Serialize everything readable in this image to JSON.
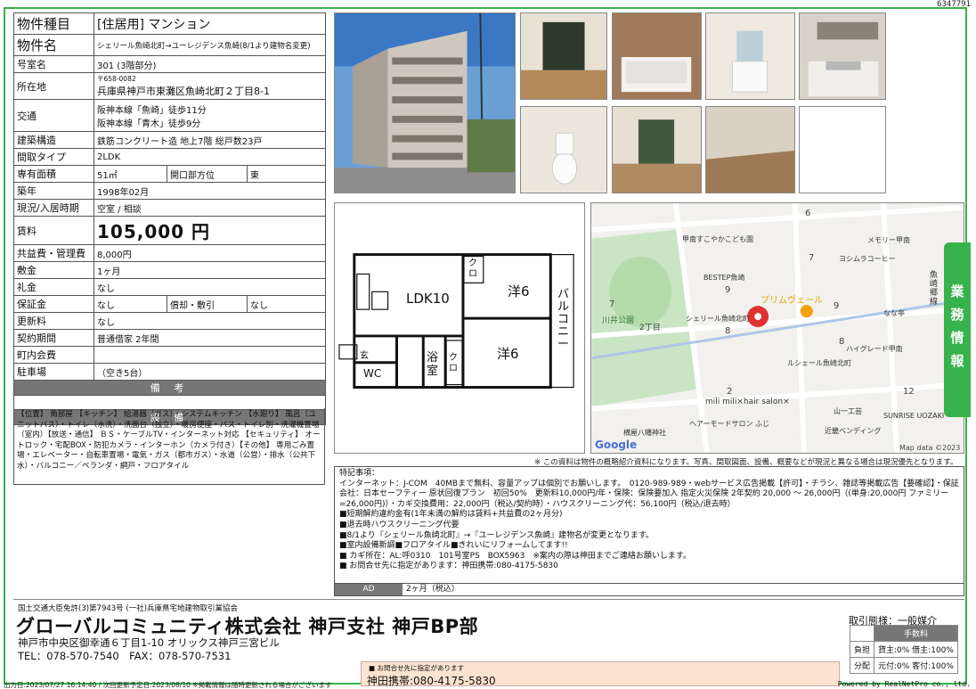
{
  "doc_id": "6347791",
  "side_tab": "業務情報",
  "property": {
    "type_label": "物件種目",
    "type_value": "[住居用] マンション",
    "name_label": "物件名",
    "name_value": "シェリール魚崎北町→ユーレジデンス魚崎(8/1より建物名変更)",
    "room_label": "号室名",
    "room_value": "301 (3階部分)",
    "address_label": "所在地",
    "postal": "〒658-0082",
    "address_value": "兵庫県神戸市東灘区魚崎北町２丁目8-1",
    "access_label": "交通",
    "access_1": "阪神本線「魚崎」徒歩11分",
    "access_2": "阪神本線「青木」徒歩9分",
    "structure_label": "建築構造",
    "structure_value": "鉄筋コンクリート造 地上7階 総戸数23戸",
    "layout_label": "間取タイプ",
    "layout_value": "2LDK",
    "area_label": "専有面積",
    "area_value": "51㎡",
    "direction_label": "開口部方位",
    "direction_value": "東",
    "built_label": "築年",
    "built_value": "1998年02月",
    "status_label": "現況/入居時期",
    "status_value": "空室 / 相談",
    "rent_label": "賃料",
    "rent_value": "105,000 円",
    "common_label": "共益費・管理費",
    "common_value": "8,000円",
    "deposit_label": "敷金",
    "deposit_value": "1ヶ月",
    "key_money_label": "礼金",
    "key_money_value": "なし",
    "guarantee_label": "保証金",
    "guarantee_value": "なし",
    "amort_label": "償却・敷引",
    "amort_value": "なし",
    "renewal_label": "更新料",
    "renewal_value": "なし",
    "contract_label": "契約期間",
    "contract_value": "普通借家 2年間",
    "town_fee_label": "町内会費",
    "town_fee_value": "",
    "parking_label": "駐車場",
    "parking_value": "（空き5台）",
    "remarks_header": "備 考",
    "equipment_header": "設 備",
    "equipment_text": "【位置】 角部屋 【キッチン】 給湯器（ガス）・システムキッチン 【水廻り】 風呂（ユニットバス）・トイレ（水洗）・洗面台（独立）・暖房便座・バス・トイレ別・洗濯機置場（室内）【放送・通信】 ＢＳ・ケーブルTV・インターネット対応 【セキュリティ】 オートロック・宅配BOX・防犯カメラ・インターホン（カメラ付き）【その他】 専用ごみ置場・エレベーター・自転車置場・電気・ガス（都市ガス）・水道（公営）・排水（公共下水）・バルコニー／ベランダ・網戸・フロアタイル"
  },
  "floorplan": {
    "ldk": "LDK10",
    "room1": "洋6",
    "room2": "洋6",
    "balcony": "バルコニー",
    "closet": "クロ",
    "entrance": "玄",
    "wc": "WC",
    "bath": "浴室"
  },
  "map": {
    "labels": [
      "甲南すこやかこども園",
      "メモリー甲南",
      "ヨシムラコーヒー",
      "BESTEP魚崎",
      "プリムヴェール",
      "シェリール魚崎北町",
      "川井公園",
      "2丁目",
      "ハイグレード甲南",
      "ルシェール魚崎北町",
      "mili mili×hair salon×",
      "ヘアーモードサロン ふじ",
      "山一工芸",
      "SUNRISE UOZAKI",
      "横屋八幡神社",
      "近畿ベンディング",
      "なな亭",
      "魚崎郷線",
      "Google",
      "Map data ©2023"
    ],
    "numbers": [
      "6",
      "7",
      "9",
      "9",
      "7",
      "8",
      "8",
      "2",
      "12"
    ]
  },
  "disclaimer": "※ この資料は物件の概略紹介資料になります。写真、間取図面、設備、概要などが現況と異なる場合は現況優先となります。",
  "remarks": [
    "特記事項：",
    "インターネット：J-COM　40MBまで無料、容量アップは個別でお願いします。　0120-989-989・webサービス広告掲載【許可】・チラシ、雑誌等掲載広告【要確認】・保証会社：日本セーフティー 原状回復プラン　初回50%　更新料10,000円/年・保険：保険要加入 指定火災保険 2年契約 20,000 ～ 26,000円（(単身:20,000円 ファミリー=26,000円)）・カギ交換費用：22,000円（税込/契約時）・ハウスクリーニング代：56,100円（税込/退去時）",
    "■短期解約違約金有(1年未満の解約は賃料+共益費の2ヶ月分)",
    "■退去時ハウスクリーニング代要",
    "■8/1より『シェリール魚崎北町』→『ユーレジデンス魚崎』建物名が変更となります。",
    "■室内設備新調■フロアタイル■きれいにリフォームしてます!!",
    "■ カギ所在：AL:呼0310　101号室PS　BOX5963　※案内の際は神田までご連絡お願いします。",
    "■ お問合せ先に指定があります：神田携帯:080-4175-5830"
  ],
  "ad_label": "AD",
  "ad_value": "2ヶ月（税込）",
  "company": {
    "license": "国土交通大臣免許(3)第7943号 (一社)兵庫県宅地建物取引業協会",
    "name": "グローバルコミュニティ株式会社 神戸支社 神戸BP部",
    "address": "神戸市中央区御幸通６丁目1-10 オリックス神戸三宮ビル",
    "tel": "TEL：078-570-7540　FAX：078-570-7531"
  },
  "contact": {
    "small": "■ お問合せ先に指定があります",
    "big": "神田携帯:080-4175-5830"
  },
  "deal": {
    "mode": "取引態様：一般媒介",
    "fee_header": "手数料",
    "burden_label": "負担",
    "burden_value": "貸主:0% 借主:100%",
    "split_label": "分配",
    "split_value": "元付:0% 客付:100%"
  },
  "footer_left": "出力日:2023/07/27 16:14:40 / 次回更新予定日:2023/08/10 ※掲載情報は随時更新される場合がございます",
  "footer_right": "Powered by RealNetPro co., ltd.",
  "colors": {
    "accent_green": "#37b24d",
    "map_pin": "#e03131",
    "contact_bg": "#fbe3cf"
  }
}
